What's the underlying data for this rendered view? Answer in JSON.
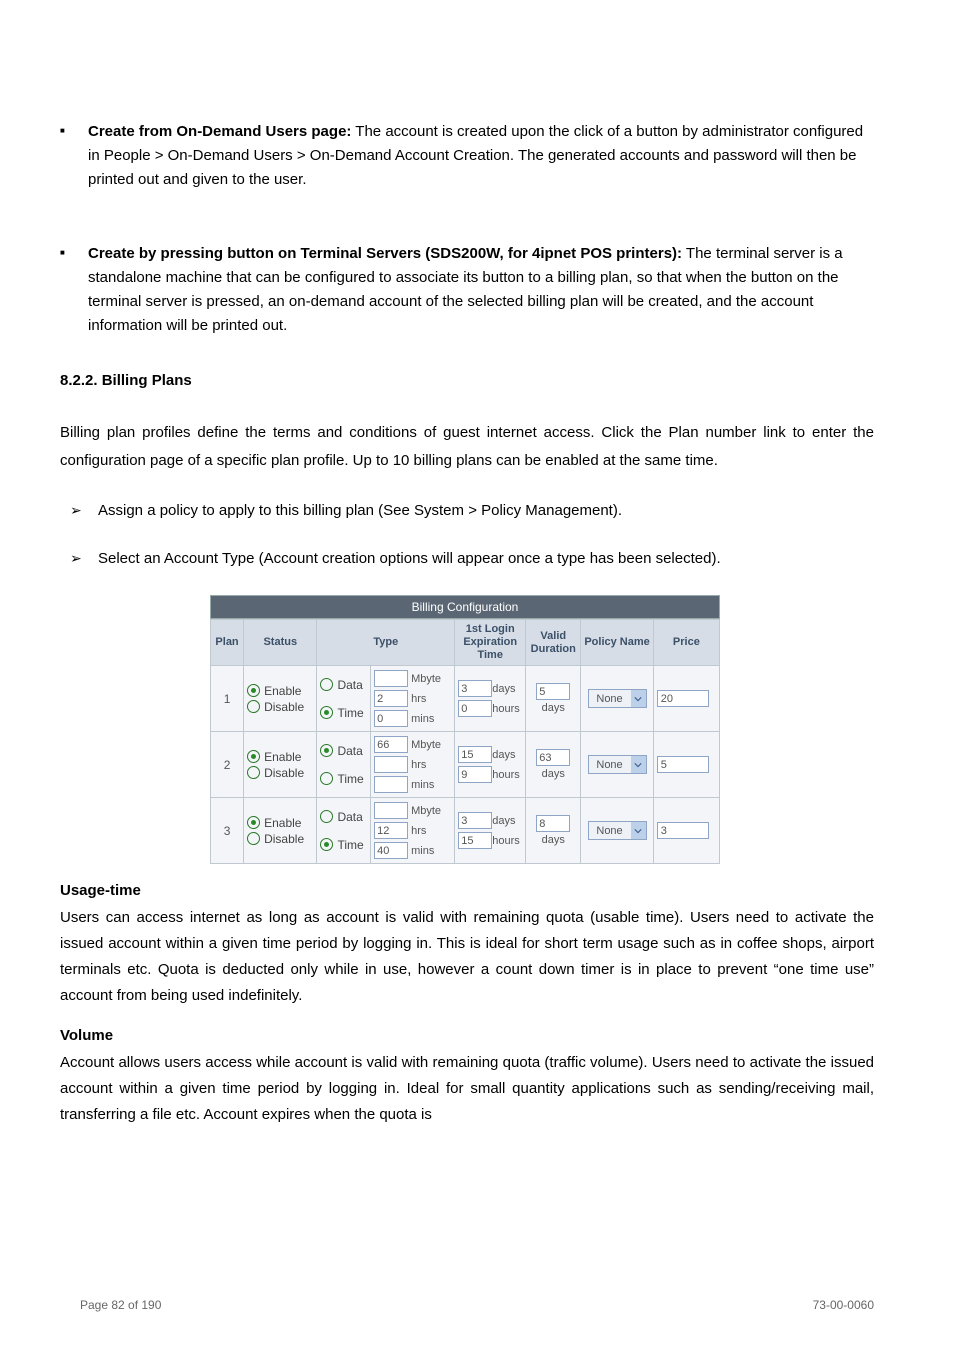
{
  "text": {
    "bullet1_bold": "Create from On-Demand Users page:",
    "bullet1_rest": " The account is created upon the click of a button by administrator configured in People > On-Demand Users > On-Demand Account Creation. The generated accounts and password will then be printed out and given to the user.",
    "bullet2_bold": "Create by pressing button on Terminal Servers (SDS200W, for 4ipnet POS printers):",
    "bullet2_rest": " The terminal server is a standalone machine that can be configured to associate its button to a billing plan, so that when the button on the terminal server is pressed, an on-demand account of the selected billing plan will be created, and the account information will be printed out.",
    "section_num": "8.2.2. Billing Plans",
    "intro": "Billing plan profiles define the terms and conditions of guest internet access. Click the Plan number link to enter the configuration page of a specific plan profile. Up to 10 billing plans can be enabled at the same time.",
    "arrow1": "Assign a policy to apply to this billing plan (See System > Policy Management).",
    "arrow2": "Select an Account Type (Account creation options will appear once a type has been selected).",
    "h_usage": "Usage-time",
    "b_usage": "Users can access internet as long as account is valid with remaining quota (usable time). Users need to activate the issued account within a given time period by logging in. This is ideal for short term usage such as in coffee shops, airport terminals etc. Quota is deducted only while in use, however a count down timer is in place to prevent “one time use” account from being used indefinitely.",
    "h_vol": "Volume",
    "b_vol": "Account allows users access while account is valid with remaining quota (traffic volume). Users need to activate the issued account within a given time period by logging in. Ideal for small quantity applications such as sending/receiving mail, transferring a file etc. Account expires when the quota is",
    "footer_left": "Page 82 of 190",
    "footer_right": "73-00-0060"
  },
  "table": {
    "title": "Billing Configuration",
    "headers": {
      "plan": "Plan",
      "status": "Status",
      "type": "Type",
      "exp": "1st Login Expiration Time",
      "valid": "Valid Duration",
      "policy": "Policy Name",
      "price": "Price"
    },
    "labels": {
      "enable": "Enable",
      "disable": "Disable",
      "data": "Data",
      "time": "Time",
      "mbyte": "Mbyte",
      "hrs": "hrs",
      "mins": "mins",
      "days": "days",
      "hours": "hours"
    },
    "rows": [
      {
        "plan": "1",
        "status_sel": "enable",
        "type_sel": "time",
        "mbyte": "",
        "hrs": "2",
        "mins": "0",
        "exp_days": "3",
        "exp_hours": "0",
        "valid": "5",
        "policy": "None",
        "price": "20"
      },
      {
        "plan": "2",
        "status_sel": "enable",
        "type_sel": "data",
        "mbyte": "66",
        "hrs": "",
        "mins": "",
        "exp_days": "15",
        "exp_hours": "9",
        "valid": "63",
        "policy": "None",
        "price": "5"
      },
      {
        "plan": "3",
        "status_sel": "enable",
        "type_sel": "time",
        "mbyte": "",
        "hrs": "12",
        "mins": "40",
        "exp_days": "3",
        "exp_hours": "15",
        "valid": "8",
        "policy": "None",
        "price": "3"
      }
    ]
  }
}
